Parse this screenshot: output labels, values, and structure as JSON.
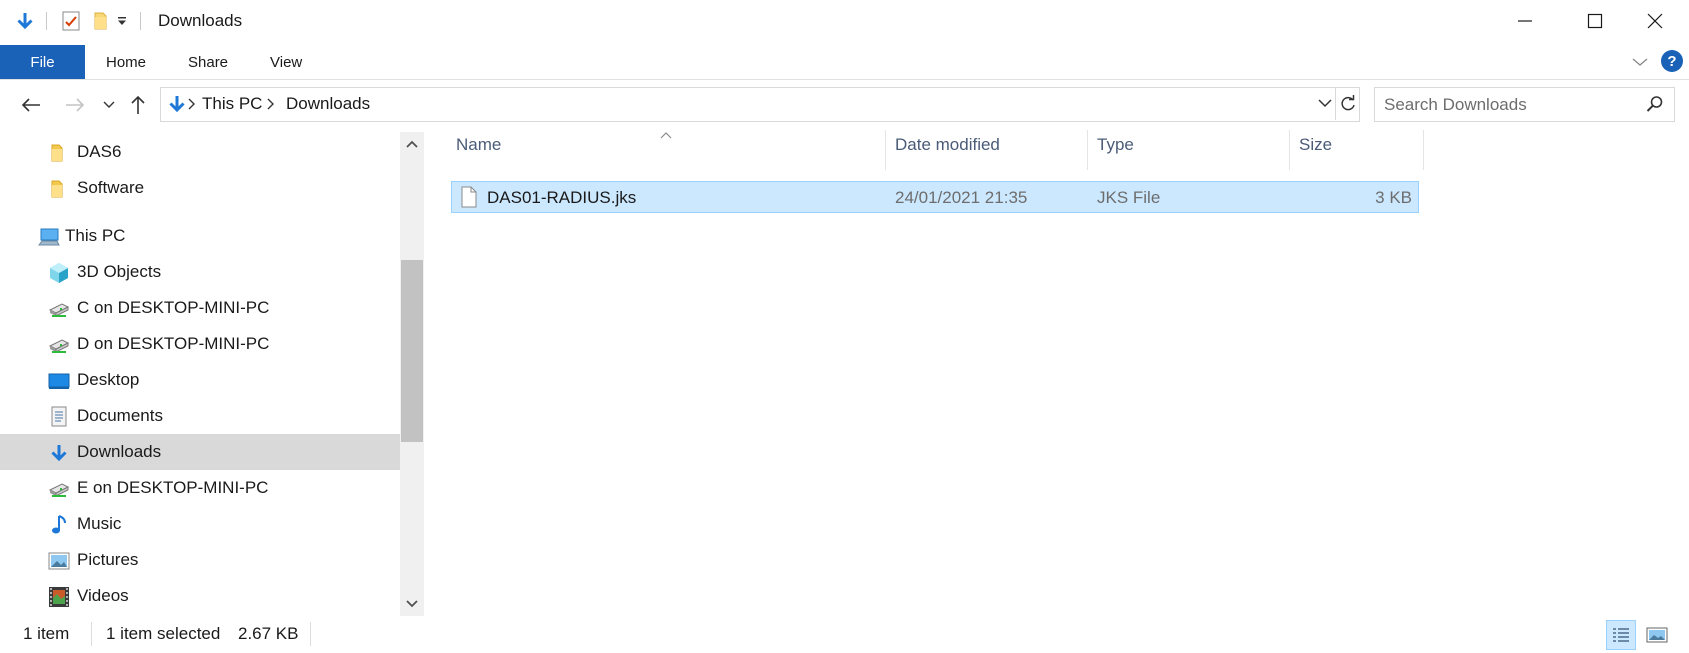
{
  "window": {
    "title": "Downloads",
    "controls": {
      "minimize": "minimize",
      "maximize": "maximize",
      "close": "close"
    }
  },
  "quick_access": [
    {
      "name": "downloads-arrow-icon"
    },
    {
      "name": "properties-icon"
    },
    {
      "name": "new-folder-icon"
    },
    {
      "name": "customize-qat-icon"
    }
  ],
  "ribbon": {
    "tabs": [
      {
        "label": "File",
        "active": true
      },
      {
        "label": "Home"
      },
      {
        "label": "Share"
      },
      {
        "label": "View"
      }
    ],
    "help_label": "?"
  },
  "address": {
    "breadcrumbs": [
      "This PC",
      "Downloads"
    ]
  },
  "search": {
    "placeholder": "Search Downloads"
  },
  "nav_pane": {
    "items": [
      {
        "label": "DAS6",
        "icon": "folder-icon"
      },
      {
        "label": "Software",
        "icon": "folder-icon"
      },
      {
        "label": "This PC",
        "icon": "this-pc-icon"
      },
      {
        "label": "3D Objects",
        "icon": "3d-objects-icon"
      },
      {
        "label": "C on DESKTOP-MINI-PC",
        "icon": "network-drive-icon"
      },
      {
        "label": "D on DESKTOP-MINI-PC",
        "icon": "network-drive-icon"
      },
      {
        "label": "Desktop",
        "icon": "desktop-icon"
      },
      {
        "label": "Documents",
        "icon": "documents-icon"
      },
      {
        "label": "Downloads",
        "icon": "downloads-icon",
        "selected": true
      },
      {
        "label": "E on DESKTOP-MINI-PC",
        "icon": "network-drive-icon"
      },
      {
        "label": "Music",
        "icon": "music-icon"
      },
      {
        "label": "Pictures",
        "icon": "pictures-icon"
      },
      {
        "label": "Videos",
        "icon": "videos-icon"
      }
    ]
  },
  "file_list": {
    "columns": [
      "Name",
      "Date modified",
      "Type",
      "Size"
    ],
    "rows": [
      {
        "name": "DAS01-RADIUS.jks",
        "date": "24/01/2021 21:35",
        "type": "JKS File",
        "size": "3 KB",
        "selected": true
      }
    ]
  },
  "status_bar": {
    "count": "1 item",
    "selected": "1 item selected",
    "size": "2.67 KB"
  },
  "colors": {
    "accent": "#1a62b8",
    "selection": "#cce8ff",
    "selection_border": "#99d1ff",
    "column_header": "#4a5b78"
  }
}
